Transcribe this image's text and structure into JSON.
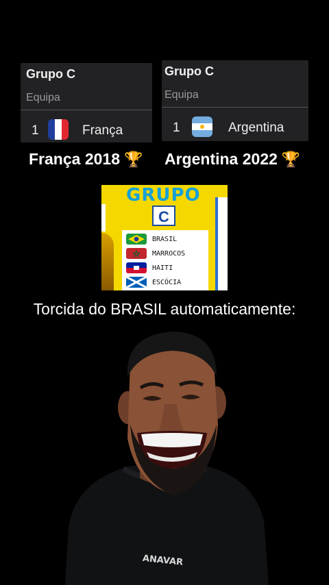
{
  "left_card": {
    "title": "Grupo C",
    "column": "Equipa",
    "rank": "1",
    "country": "França"
  },
  "right_card": {
    "title": "Grupo C",
    "column": "Equipa",
    "rank": "1",
    "country": "Argentina"
  },
  "captions": {
    "left": "França 2018",
    "right": "Argentina 2022",
    "trophy_icon": "trophy-icon"
  },
  "poster": {
    "heading": "GRUPO",
    "group_letter": "C",
    "teams": [
      "BRASIL",
      "MARROCOS",
      "HAITI",
      "ESCÓCIA"
    ]
  },
  "headline": "Torcida do BRASIL automaticamente:",
  "shirt_text": "ANAVAR",
  "colors": {
    "background": "#000000",
    "card": "#222225",
    "poster_yellow": "#f4d800",
    "poster_blue": "#15a0d8"
  }
}
